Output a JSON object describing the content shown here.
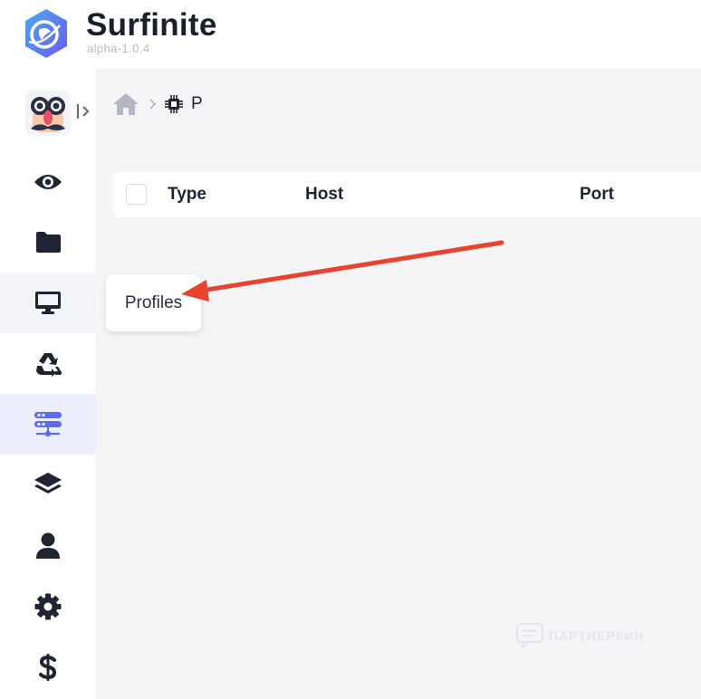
{
  "app": {
    "name": "Surfinite",
    "version": "alpha-1.0.4",
    "accent_color": "#5b6cf0"
  },
  "sidebar": {
    "avatar_icon": "disguise-glasses-mustache",
    "items": [
      {
        "id": "view",
        "icon": "eye-icon",
        "state": "normal"
      },
      {
        "id": "folders",
        "icon": "folder-icon",
        "state": "normal"
      },
      {
        "id": "profiles",
        "icon": "monitor-icon",
        "state": "hover",
        "tooltip": "Profiles"
      },
      {
        "id": "recycle",
        "icon": "recycle-icon",
        "state": "normal"
      },
      {
        "id": "proxies",
        "icon": "server-icon",
        "state": "active"
      },
      {
        "id": "layers",
        "icon": "layers-icon",
        "state": "normal"
      },
      {
        "id": "account",
        "icon": "user-icon",
        "state": "normal"
      },
      {
        "id": "settings",
        "icon": "gear-icon",
        "state": "normal"
      },
      {
        "id": "billing",
        "icon": "dollar-icon",
        "state": "normal"
      }
    ]
  },
  "breadcrumb": {
    "home_icon": "home-icon",
    "current_icon": "chip-icon",
    "current_label": "P"
  },
  "table": {
    "columns": [
      "Type",
      "Host",
      "Port"
    ]
  },
  "tooltip": {
    "label": "Profiles"
  },
  "annotation": {
    "arrow_color": "#e8432e"
  },
  "watermark": {
    "text": "ПАРТНЕРКИН"
  }
}
